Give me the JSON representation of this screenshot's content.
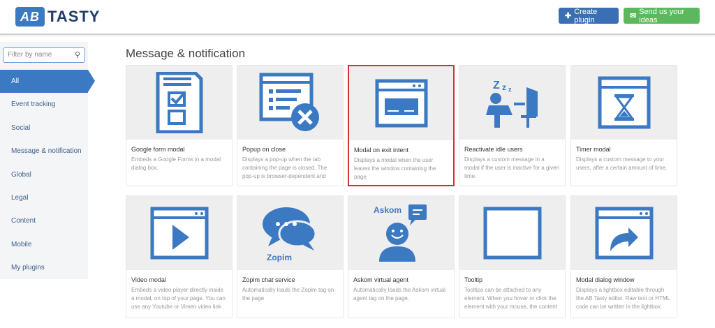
{
  "header": {
    "logo_mark": "AB",
    "logo_text": "TASTY",
    "create_plugin": "Create plugin",
    "send_ideas": "Send us your ideas"
  },
  "sidebar": {
    "filter_placeholder": "Filter by name",
    "items": [
      {
        "label": "All",
        "active": true
      },
      {
        "label": "Event tracking"
      },
      {
        "label": "Social"
      },
      {
        "label": "Message & notification"
      },
      {
        "label": "Global"
      },
      {
        "label": "Legal"
      },
      {
        "label": "Content"
      },
      {
        "label": "Mobile"
      },
      {
        "label": "My plugins"
      }
    ]
  },
  "main": {
    "title": "Message & notification",
    "cards": [
      {
        "name": "Google form modal",
        "desc": "Embeds a Google Forms in a modal dialog box.",
        "icon": "form-checklist-icon"
      },
      {
        "name": "Popup on close",
        "desc": "Displays a pop-up when the tab containing the page is closed. The pop-up is browser-dependent and",
        "icon": "popup-close-icon"
      },
      {
        "name": "Modal on exit intent",
        "desc": "Displays a modal when the user leaves the window containing the page",
        "icon": "exit-modal-icon",
        "highlighted": true
      },
      {
        "name": "Reactivate idle users",
        "desc": "Displays a custom message in a modal if the user is inactive for a given time.",
        "icon": "idle-user-icon"
      },
      {
        "name": "Timer modal",
        "desc": "Displays a custom message to your users, after a certain amount of time.",
        "icon": "hourglass-icon"
      },
      {
        "name": "Video modal",
        "desc": "Embeds a video player directly inside a modal, on top of your page. You can use any Youtube or Vimeo video link",
        "icon": "video-play-icon"
      },
      {
        "name": "Zopim chat service",
        "desc": "Automatically loads the Zopim tag on the page",
        "icon": "chat-bubbles-icon",
        "brand": "Zopim"
      },
      {
        "name": "Askom virtual agent",
        "desc": "Automatically loads the Askom virtual agent tag on the page.",
        "icon": "virtual-agent-icon",
        "brand": "Askom"
      },
      {
        "name": "Tooltip",
        "desc": "Tooltips can be attached to any element. When you hover or click the element with your mouse, the content",
        "icon": "code-tag-icon",
        "code": "</>"
      },
      {
        "name": "Modal dialog window",
        "desc": "Displays a lightbox editable through the AB Tasty editor. Raw text or HTML code can be written in the lightbox.",
        "icon": "lightbox-arrow-icon"
      }
    ]
  },
  "colors": {
    "accent": "#3b79c2",
    "icon": "#3b79c2",
    "green": "#5cb85c",
    "highlight": "#d42f3f"
  }
}
